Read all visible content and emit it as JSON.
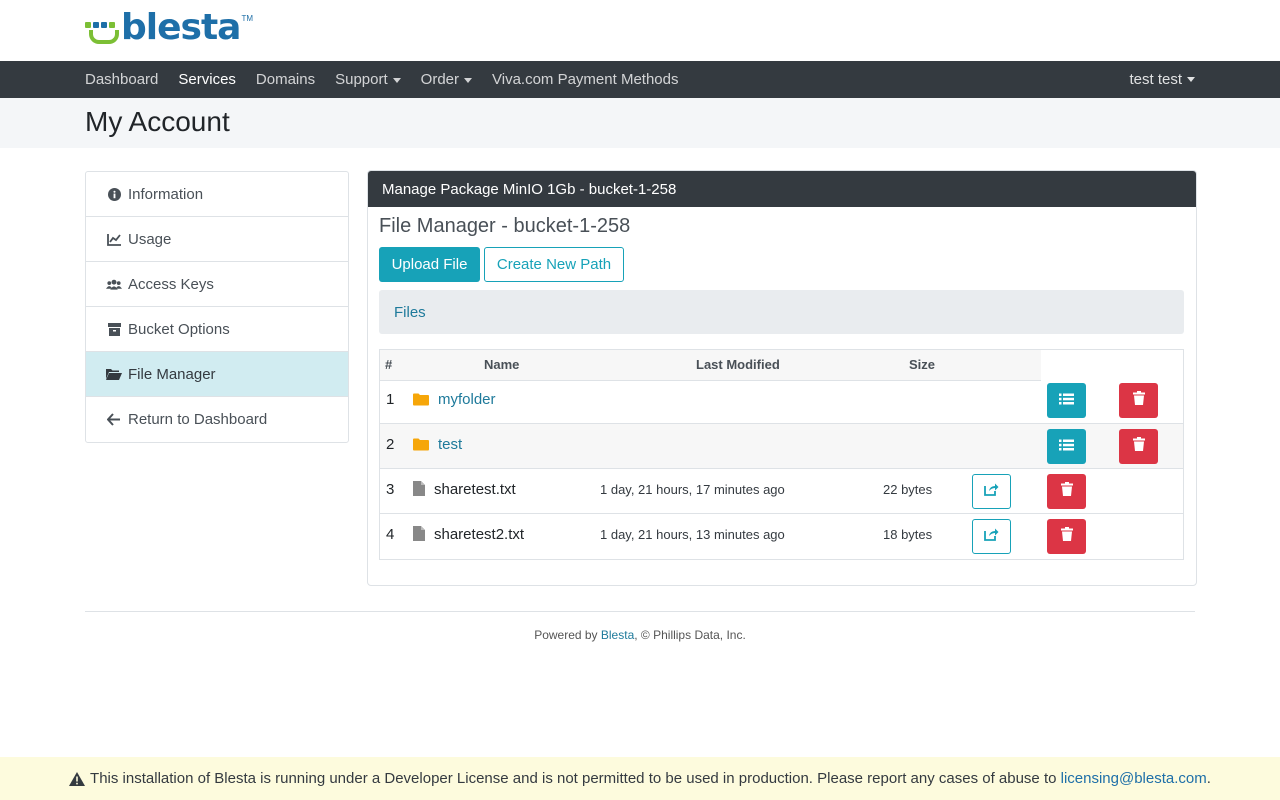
{
  "brand": {
    "name": "blesta",
    "tm": "TM",
    "colors": {
      "blue": "#1e6fa8",
      "green": "#7cbf35"
    }
  },
  "nav": {
    "items": [
      {
        "label": "Dashboard"
      },
      {
        "label": "Services",
        "active": true
      },
      {
        "label": "Domains"
      },
      {
        "label": "Support",
        "dropdown": true
      },
      {
        "label": "Order",
        "dropdown": true
      },
      {
        "label": "Viva.com Payment Methods"
      }
    ],
    "user": "test test"
  },
  "page": {
    "title": "My Account"
  },
  "sidebar": {
    "items": [
      {
        "label": "Information",
        "icon": "info-circle-icon"
      },
      {
        "label": "Usage",
        "icon": "chart-line-icon"
      },
      {
        "label": "Access Keys",
        "icon": "users-icon"
      },
      {
        "label": "Bucket Options",
        "icon": "archive-box-icon"
      },
      {
        "label": "File Manager",
        "icon": "folder-open-icon",
        "active": true
      },
      {
        "label": "Return to Dashboard",
        "icon": "arrow-left-icon"
      }
    ]
  },
  "card": {
    "header": "Manage Package MinIO 1Gb - bucket-1-258",
    "fm_title": "File Manager - bucket-1-258",
    "upload_label": "Upload File",
    "create_path_label": "Create New Path",
    "breadcrumb": "Files"
  },
  "table": {
    "headers": {
      "num": "#",
      "name": "Name",
      "modified": "Last Modified",
      "size": "Size"
    },
    "rows": [
      {
        "num": "1",
        "type": "folder",
        "name": "myfolder",
        "modified": "",
        "size": ""
      },
      {
        "num": "2",
        "type": "folder",
        "name": "test",
        "modified": "",
        "size": ""
      },
      {
        "num": "3",
        "type": "file",
        "name": "sharetest.txt",
        "modified": "1 day, 21 hours, 17 minutes ago",
        "size": "22 bytes"
      },
      {
        "num": "4",
        "type": "file",
        "name": "sharetest2.txt",
        "modified": "1 day, 21 hours, 13 minutes ago",
        "size": "18 bytes"
      }
    ]
  },
  "footer": {
    "prefix": "Powered by ",
    "link": "Blesta",
    "suffix": ", © Phillips Data, Inc."
  },
  "license": {
    "text": "This installation of Blesta is running under a Developer License and is not permitted to be used in production. Please report any cases of abuse to ",
    "email": "licensing@blesta.com",
    "end": "."
  }
}
